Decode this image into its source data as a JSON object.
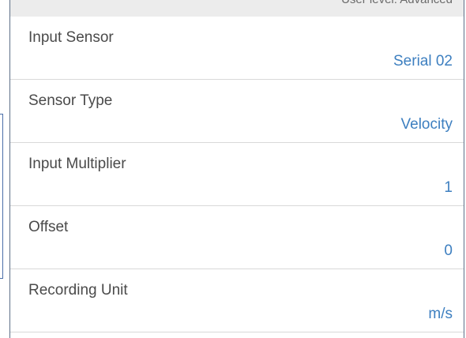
{
  "header": {
    "user_level": "User level: Advanced"
  },
  "settings": {
    "rows": [
      {
        "label": "Input Sensor",
        "value": "Serial 02"
      },
      {
        "label": "Sensor Type",
        "value": "Velocity"
      },
      {
        "label": "Input Multiplier",
        "value": "1"
      },
      {
        "label": "Offset",
        "value": "0"
      },
      {
        "label": "Recording Unit",
        "value": "m/s"
      }
    ]
  },
  "colors": {
    "value_text": "#3d7fc0",
    "label_text": "#4a4a4a",
    "panel_border": "#5d6f88",
    "header_bg": "#ececec"
  }
}
